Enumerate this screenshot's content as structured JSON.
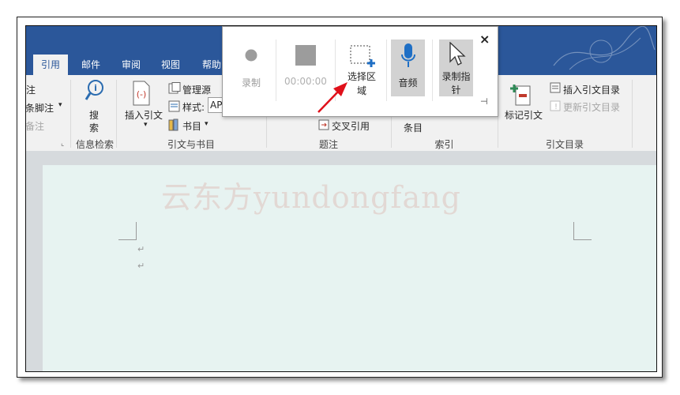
{
  "ribbon": {
    "tabs": [
      {
        "label": "引用",
        "active": true
      },
      {
        "label": "邮件"
      },
      {
        "label": "审阅"
      },
      {
        "label": "视图"
      },
      {
        "label": "帮助"
      }
    ],
    "footnotes": {
      "item1": "脚注",
      "item2": "下一条脚注",
      "item3": "显示备注"
    },
    "research": {
      "search_line1": "搜",
      "search_line2": "索",
      "group": "信息检索"
    },
    "citations": {
      "insert": "插入引文",
      "manage": "管理源",
      "style_label": "样式:",
      "style_value": "APA",
      "bibliography": "书目",
      "group": "引文与书目"
    },
    "captions": {
      "cross_ref": "交叉引用",
      "group": "题注"
    },
    "index": {
      "mark_entry": "条目",
      "group": "索引"
    },
    "toa": {
      "mark_citation": "标记引文",
      "insert_table": "插入引文目录",
      "update_table": "更新引文目录",
      "group": "引文目录"
    }
  },
  "document": {
    "watermark": "云东方yundongfang",
    "paragraph_mark": "↵"
  },
  "recorder": {
    "record": "录制",
    "timer": "00:00:00",
    "select_area_line1": "选择区",
    "select_area_line2": "域",
    "audio": "音频",
    "pointer_line1": "录制指",
    "pointer_line2": "针",
    "close": "×",
    "pin": "⊣"
  },
  "colors": {
    "ribbon_blue": "#2b579a",
    "ribbon_bg": "#f1f1f1",
    "page_bg": "#e7f3f1",
    "arrow": "#e0101a",
    "selected_button": "#d2d2d2"
  }
}
